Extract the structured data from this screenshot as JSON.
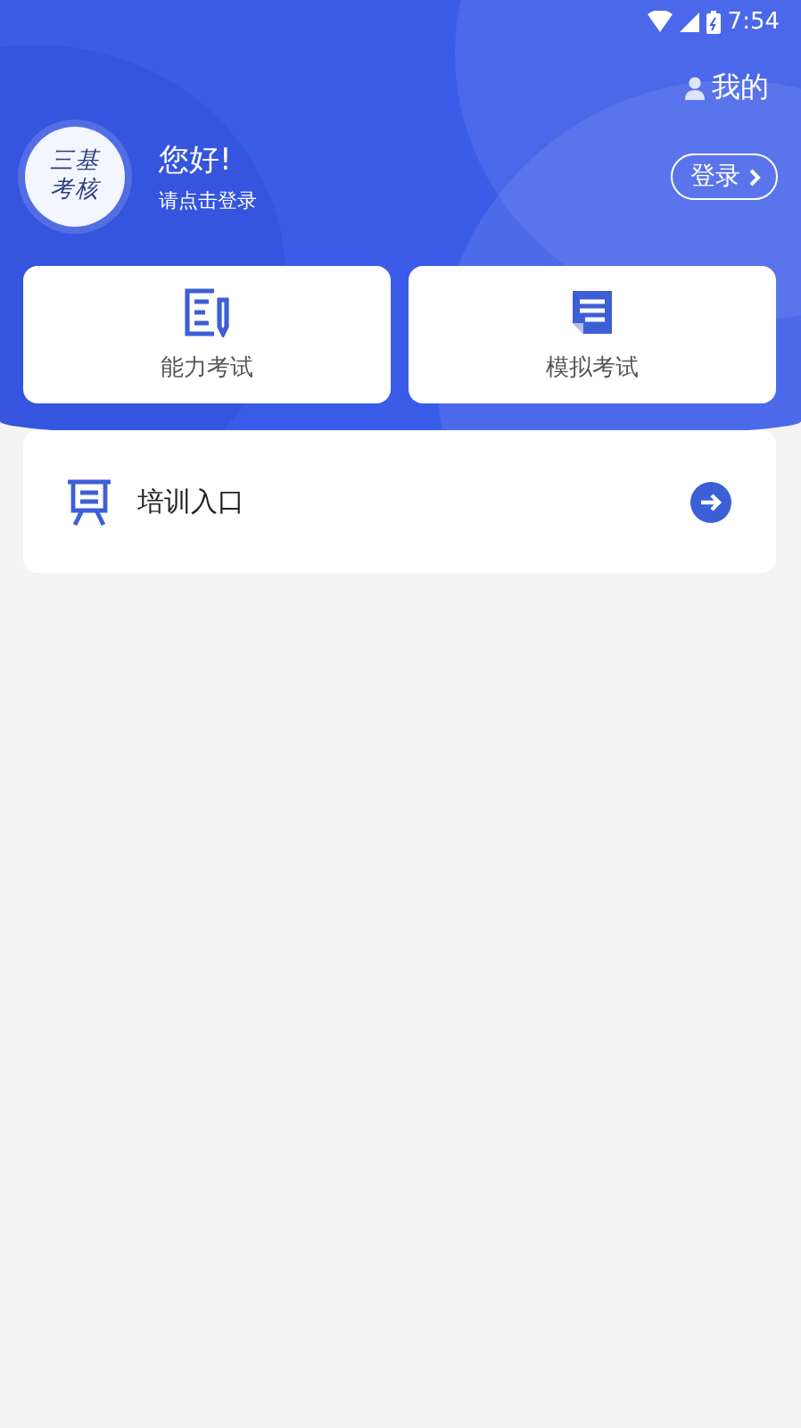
{
  "status_bar": {
    "time": "7:54"
  },
  "header": {
    "my_link": "我的",
    "avatar_text": [
      "三基",
      "考核"
    ],
    "greeting": "您好!",
    "subtitle": "请点击登录",
    "login_button": "登录"
  },
  "exam_cards": [
    {
      "label": "能力考试",
      "kind": "ability"
    },
    {
      "label": "模拟考试",
      "kind": "mock"
    }
  ],
  "training_entry": {
    "label": "培训入口"
  }
}
